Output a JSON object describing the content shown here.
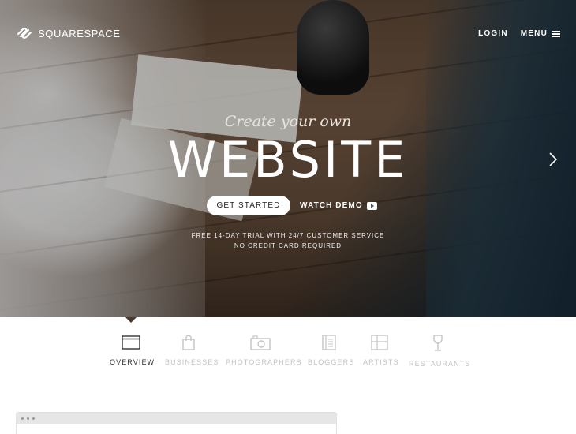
{
  "brand": {
    "name": "SQUARESPACE"
  },
  "nav": {
    "login": "LOGIN",
    "menu": "MENU"
  },
  "hero": {
    "tagline": "Create your own",
    "headline": "WEBSITE",
    "cta_primary": "GET STARTED",
    "cta_secondary": "WATCH DEMO",
    "fineprint_line1": "FREE 14-DAY TRIAL WITH 24/7 CUSTOMER SERVICE",
    "fineprint_line2": "NO CREDIT CARD REQUIRED"
  },
  "categories": [
    {
      "label": "OVERVIEW",
      "icon": "browser-window-icon",
      "active": true
    },
    {
      "label": "BUSINESSES",
      "icon": "shopping-bag-icon",
      "active": false
    },
    {
      "label": "PHOTOGRAPHERS",
      "icon": "camera-icon",
      "active": false
    },
    {
      "label": "BLOGGERS",
      "icon": "notebook-icon",
      "active": false
    },
    {
      "label": "ARTISTS",
      "icon": "grid-frame-icon",
      "active": false
    },
    {
      "label": "RESTAURANTS",
      "icon": "wine-glass-icon",
      "active": false
    }
  ],
  "colors": {
    "active_text": "#333333",
    "inactive_text": "#c4c4c4",
    "hero_text": "#ffffff"
  }
}
